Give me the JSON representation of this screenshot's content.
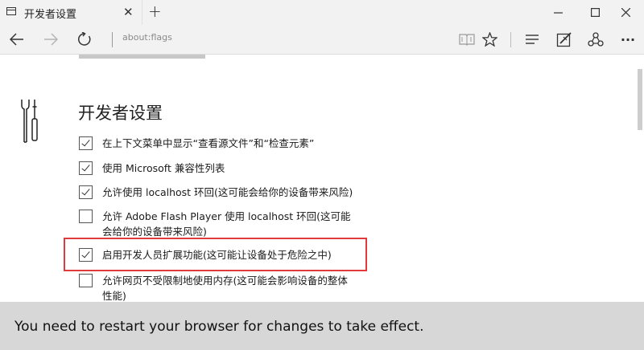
{
  "tab": {
    "title": "开发者设置",
    "close_glyph": "✕",
    "new_tab_glyph": "+"
  },
  "window_controls": {
    "minimize_glyph": "—",
    "maximize_glyph": "☐",
    "close_glyph": "✕"
  },
  "navbar": {
    "address": "about:flags",
    "more_glyph": "···"
  },
  "content": {
    "section_title": "开发者设置",
    "options": [
      {
        "label_lines": [
          "在上下文菜单中显示“查看源文件”和“检查元素”"
        ],
        "checked": true
      },
      {
        "label_lines": [
          "使用 Microsoft 兼容性列表"
        ],
        "checked": true
      },
      {
        "label_lines": [
          "允许使用 localhost 环回(这可能会给你的设备带来风险)"
        ],
        "checked": true
      },
      {
        "label_lines": [
          "允许 Adobe Flash Player 使用 localhost 环回(这可能",
          "会给你的设备带来风险)"
        ],
        "checked": false
      },
      {
        "label_lines": [
          "启用开发人员扩展功能(这可能让设备处于危险之中)"
        ],
        "checked": true
      },
      {
        "label_lines": [
          "允许网页不受限制地使用内存(这可能会影响设备的整体",
          "性能)"
        ],
        "checked": false
      }
    ]
  },
  "banner": {
    "message": "You need to restart your browser for changes to take effect."
  },
  "colors": {
    "chrome_bg": "#f2f2f2",
    "banner_bg": "#d7d7d7",
    "highlight_border": "#e03a3a"
  }
}
